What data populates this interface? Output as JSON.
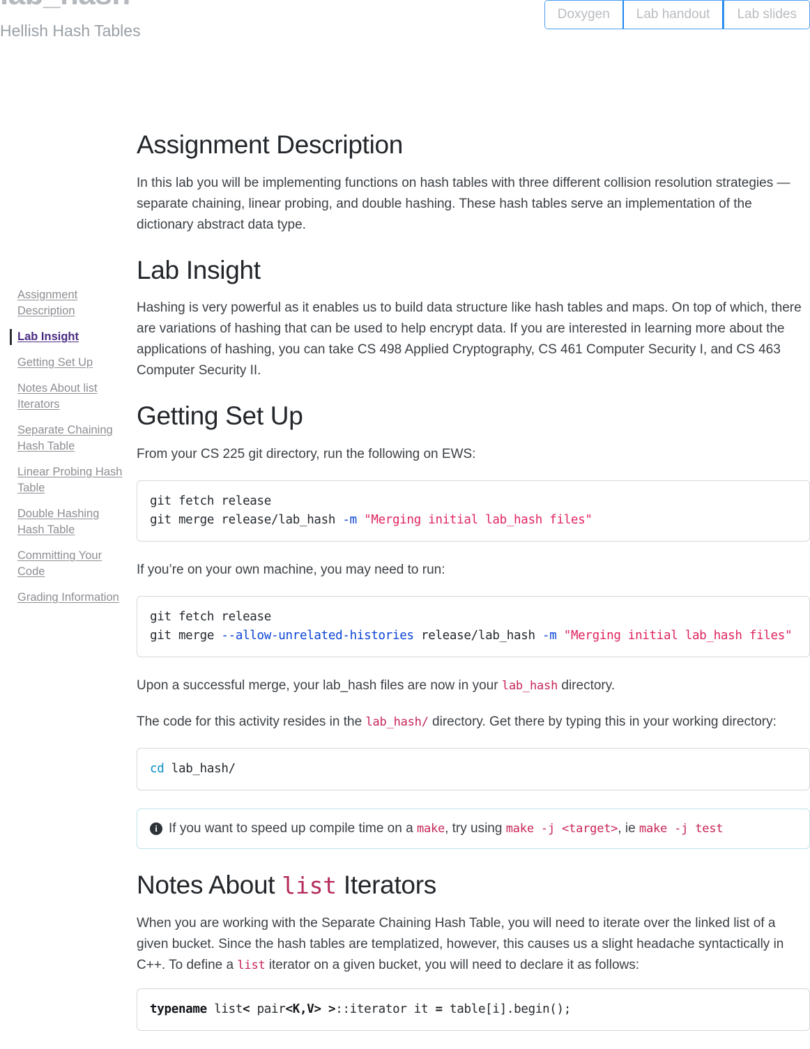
{
  "masthead": {
    "title": "lab_hash",
    "subtitle": "Hellish Hash Tables"
  },
  "nav": {
    "buttons": [
      {
        "label": "Doxygen",
        "active": false
      },
      {
        "label": "Lab handout",
        "active": true
      },
      {
        "label": "Lab slides",
        "active": false
      }
    ]
  },
  "toc": {
    "items": [
      {
        "label": "Assignment Description",
        "active": false
      },
      {
        "label": "Lab Insight",
        "active": true
      },
      {
        "label": "Getting Set Up",
        "active": false
      },
      {
        "label": "Notes About list Iterators",
        "active": false
      },
      {
        "label": "Separate Chaining Hash Table",
        "active": false
      },
      {
        "label": "Linear Probing Hash Table",
        "active": false
      },
      {
        "label": "Double Hashing Hash Table",
        "active": false
      },
      {
        "label": "Committing Your Code",
        "active": false
      },
      {
        "label": "Grading Information",
        "active": false
      }
    ]
  },
  "content": {
    "assignment_description": {
      "heading": "Assignment Description",
      "paragraph": "In this lab you will be implementing functions on hash tables with three different collision resolution strategies — separate chaining, linear probing, and double hashing. These hash tables serve an implementation of the dictionary abstract data type."
    },
    "lab_insight": {
      "heading": "Lab Insight",
      "paragraph": "Hashing is very powerful as it enables us to build data structure like hash tables and maps. On top of which, there are variations of hashing that can be used to help encrypt data. If you are interested in learning more about the applications of hashing, you can take CS 498 Applied Cryptography, CS 461 Computer Security I, and CS 463 Computer Security II."
    },
    "getting_set_up": {
      "heading": "Getting Set Up",
      "intro_ews": "From your CS 225 git directory, run the following on EWS:",
      "code_ews": {
        "line1_plain": "git fetch release",
        "line2_prefix": "git merge release/lab_hash ",
        "line2_flag": "-m",
        "line2_string": " \"Merging initial lab_hash files\""
      },
      "intro_own_machine": "If you’re on your own machine, you may need to run:",
      "code_own_machine": {
        "line1_plain": "git fetch release",
        "line2_prefix": "git merge ",
        "line2_flag1": "--allow-unrelated-histories",
        "line2_mid": " release/lab_hash ",
        "line2_flag2": "-m",
        "line2_string": " \"Merging initial lab_hash files\""
      },
      "after_merge_1": "Upon a successful merge, your lab_hash files are now in your ",
      "after_merge_code": "lab_hash",
      "after_merge_2": " directory.",
      "code_dir_1": "The code for this activity resides in the ",
      "code_dir_code": "lab_hash/",
      "code_dir_2": " directory. Get there by typing this in your working directory:",
      "code_cd": {
        "cmd": "cd",
        "rest": " lab_hash/"
      },
      "callout": {
        "icon": "info-icon",
        "text_1": "If you want to speed up compile time on a ",
        "code_1": "make",
        "text_2": ", try using ",
        "code_2": "make -j <target>",
        "text_3": ", ie ",
        "code_3": "make -j test"
      }
    },
    "notes_list_iterators": {
      "heading_part1": "Notes About ",
      "heading_code": "list",
      "heading_part2": " Iterators",
      "paragraph_1": "When you are working with the Separate Chaining Hash Table, you will need to iterate over the linked list of a given bucket. Since the hash tables are templatized, however, this causes us a slight headache syntactically in C++. To define a ",
      "paragraph_code": "list",
      "paragraph_2": " iterator on a given bucket, you will need to declare it as follows:",
      "code_iterator": {
        "kw": "typename",
        "p1": " list",
        "op1": "<",
        "p2": " pair",
        "op2": "<K,V>",
        "p3": " ",
        "op3": ">",
        "p4": "::iterator it ",
        "op4": "=",
        "p5": " table[i].begin();"
      }
    }
  },
  "colors": {
    "accent_blue": "#1a85f0",
    "code_crimson": "#c72457",
    "active_toc": "#4b2b82",
    "heading": "#22262a",
    "body_text": "#3b4045"
  }
}
